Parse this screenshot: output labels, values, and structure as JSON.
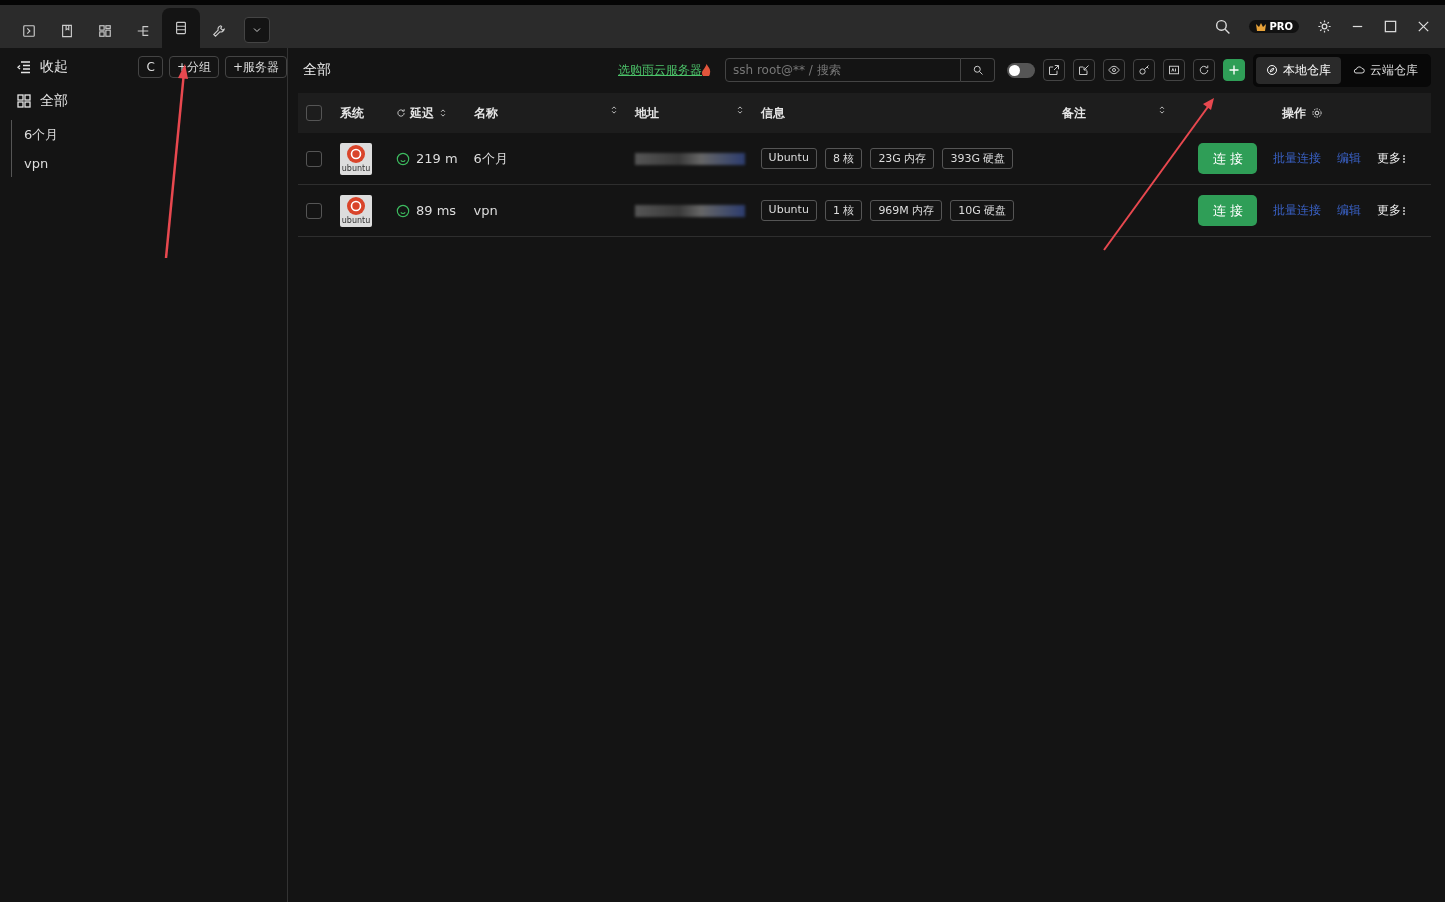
{
  "toolbar": {
    "tabs": [
      {
        "selected": false
      },
      {
        "selected": false
      },
      {
        "selected": false
      },
      {
        "selected": false
      },
      {
        "selected": true
      },
      {
        "selected": false
      }
    ],
    "badge": "PRO"
  },
  "sidebar": {
    "collapse": "收起",
    "refresh_button": "C",
    "add_group": "+分组",
    "add_server": "+服务器",
    "all": "全部",
    "groups": [
      {
        "label": "6个月"
      },
      {
        "label": "vpn"
      }
    ]
  },
  "main": {
    "title": "全部",
    "promo_link": "选购雨云服务器",
    "search": {
      "placeholder": "ssh root@** / 搜索"
    },
    "toggle_on": false,
    "repos": [
      {
        "label": "本地仓库",
        "selected": true
      },
      {
        "label": "云端仓库",
        "selected": false
      }
    ]
  },
  "table": {
    "all_checked": false,
    "columns": [
      "系统",
      "延迟",
      "名称",
      "地址",
      "信息",
      "备注",
      "操作"
    ],
    "rows": [
      {
        "checked": false,
        "os": "ubuntu",
        "latency": "219 m",
        "name": "6个月",
        "tags": [
          "Ubuntu",
          "8 核",
          "23G 内存",
          "393G 硬盘"
        ],
        "connect": "连 接",
        "batch": "批量连接",
        "edit": "编辑",
        "more": "更多"
      },
      {
        "checked": false,
        "os": "ubuntu",
        "latency": "89 ms",
        "name": "vpn",
        "tags": [
          "Ubuntu",
          "1 核",
          "969M 内存",
          "10G 硬盘"
        ],
        "connect": "连 接",
        "batch": "批量连接",
        "edit": "编辑",
        "more": "更多"
      }
    ]
  }
}
